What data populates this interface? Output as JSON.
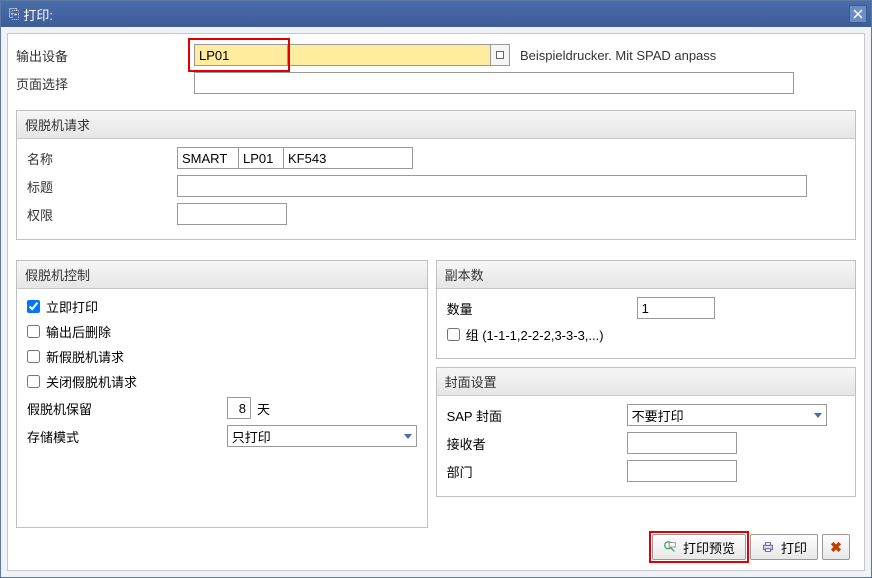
{
  "titlebar": {
    "icon": "⎘",
    "title": "打印:"
  },
  "top": {
    "output_device_label": "输出设备",
    "output_device_value": "LP01",
    "output_device_desc": "Beispieldrucker. Mit SPAD anpass",
    "page_select_label": "页面选择",
    "page_select_value": ""
  },
  "spool_request": {
    "title": "假脱机请求",
    "name_label": "名称",
    "name_part1": "SMART",
    "name_part2": "LP01",
    "name_part3": "KF543",
    "title_label": "标题",
    "title_value": "",
    "auth_label": "权限",
    "auth_value": ""
  },
  "spool_control": {
    "title": "假脱机控制",
    "print_immediately": "立即打印",
    "print_immediately_checked": true,
    "delete_after_output": "输出后删除",
    "delete_after_output_checked": false,
    "new_spool_request": "新假脱机请求",
    "new_spool_request_checked": false,
    "close_spool_request": "关闭假脱机请求",
    "close_spool_request_checked": false,
    "retention_label": "假脱机保留",
    "retention_value": "8",
    "retention_unit": "天",
    "storage_mode_label": "存储模式",
    "storage_mode_value": "只打印"
  },
  "copies": {
    "title": "副本数",
    "count_label": "数量",
    "count_value": "1",
    "group_label": "组 (1-1-1,2-2-2,3-3-3,...)",
    "group_checked": false
  },
  "cover": {
    "title": "封面设置",
    "sap_cover_label": "SAP 封面",
    "sap_cover_value": "不要打印",
    "recipient_label": "接收者",
    "recipient_value": "",
    "department_label": "部门",
    "department_value": ""
  },
  "footer": {
    "preview_label": "打印预览",
    "print_label": "打印"
  }
}
